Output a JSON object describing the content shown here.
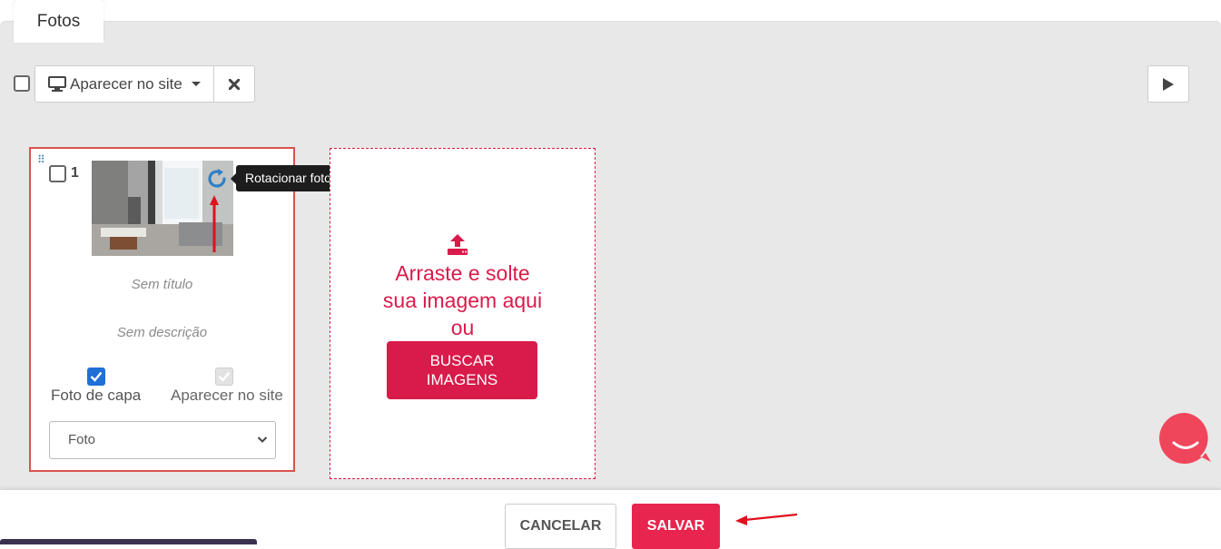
{
  "tab": {
    "label": "Fotos"
  },
  "toolbar": {
    "appear_label": "Aparecer no site",
    "monitor_icon": "monitor-icon",
    "delete_icon": "close-icon",
    "play_icon": "play-icon"
  },
  "photos": [
    {
      "number": "1",
      "title": "Sem título",
      "description": "Sem descrição",
      "cover_label": "Foto de capa",
      "cover_checked": true,
      "site_label": "Aparecer no site",
      "site_checked": true,
      "site_disabled": true,
      "type_value": "Foto"
    }
  ],
  "tooltip": {
    "text": "Rotacionar foto"
  },
  "dropzone": {
    "line1": "Arraste e solte",
    "line2": "sua imagem aqui",
    "line3": "ou",
    "button_line1": "BUSCAR",
    "button_line2": "IMAGENS"
  },
  "footer": {
    "cancel_label": "CANCELAR",
    "save_label": "SALVAR"
  },
  "colors": {
    "accent": "#d81b4a",
    "save": "#e8254e",
    "checkbox_blue": "#1f6fd6",
    "panel_bg": "#e8e8e8"
  }
}
